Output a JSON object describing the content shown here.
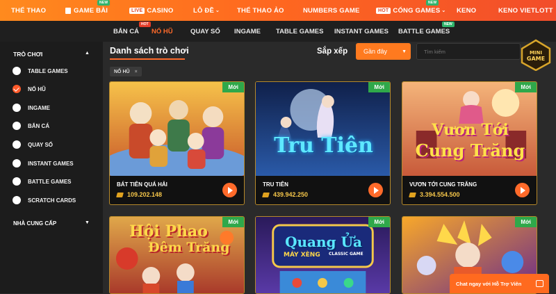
{
  "topnav": {
    "items": [
      {
        "label": "THỂ THAO"
      },
      {
        "label": "GAME BÀI",
        "badge": "NEW"
      },
      {
        "label": "CASINO",
        "prefix": "LIVE"
      },
      {
        "label": "LÔ ĐỀ"
      },
      {
        "label": "THỂ THAO ẢO"
      },
      {
        "label": "NUMBERS GAME"
      },
      {
        "label": "CỔNG GAMES",
        "prefix": "HOT",
        "badge": "NEW"
      },
      {
        "label": "KENO"
      },
      {
        "label": "KENO VIETLOTT"
      }
    ]
  },
  "subnav": {
    "items": [
      {
        "label": "BẮN CÁ"
      },
      {
        "label": "NỔ HŨ",
        "badge": "HOT"
      },
      {
        "label": "QUAY SỐ"
      },
      {
        "label": "INGAME"
      },
      {
        "label": "TABLE GAMES"
      },
      {
        "label": "INSTANT GAMES"
      },
      {
        "label": "BATTLE GAMES",
        "badge": "NEW"
      }
    ]
  },
  "sidebar": {
    "heading": "TRÒ CHƠI",
    "items": [
      {
        "label": "TABLE GAMES"
      },
      {
        "label": "NỔ HŨ"
      },
      {
        "label": "INGAME"
      },
      {
        "label": "BẮN CÁ"
      },
      {
        "label": "QUAY SỐ"
      },
      {
        "label": "INSTANT GAMES"
      },
      {
        "label": "BATTLE GAMES"
      },
      {
        "label": "SCRATCH CARDS"
      }
    ],
    "provider_heading": "NHÀ CUNG CẤP"
  },
  "main": {
    "title": "Danh sách trò chơi",
    "sort_label": "Sắp xếp",
    "sort_value": "Gần đây",
    "search_placeholder": "Tìm kiếm",
    "filter_chip": "NỔ HŨ",
    "filter_close": "×"
  },
  "mini_game": {
    "line1": "MINI",
    "line2": "GAME"
  },
  "cards": [
    {
      "tag": "Mới",
      "name": "BÁT TIÊN QUÁ HẢI",
      "jackpot": "109.202.148"
    },
    {
      "tag": "Mới",
      "name": "TRU TIÊN",
      "jackpot": "439.942.250",
      "logo": "Tru Tiên"
    },
    {
      "tag": "Mới",
      "name": "VƯƠN TỚI CUNG TRĂNG",
      "jackpot": "3.394.554.500",
      "logo1": "Vươn Tới",
      "logo2": "Cung Trăng"
    },
    {
      "tag": "Mới",
      "logo1": "Hội Phao",
      "logo2": "Đêm Trăng"
    },
    {
      "tag": "Mới",
      "logo1": "Quang Ửa",
      "logo2": "MÁY XÈNG",
      "logo3": "CLASSIC GAME"
    },
    {
      "tag": "Mới"
    }
  ],
  "chat": {
    "label": "Chat ngay với Hỗ Trợ Viên"
  },
  "colors": {
    "accent": "#ff6a2a",
    "new_green": "#2fa84a",
    "jackpot_gold": "#f5c64a"
  }
}
